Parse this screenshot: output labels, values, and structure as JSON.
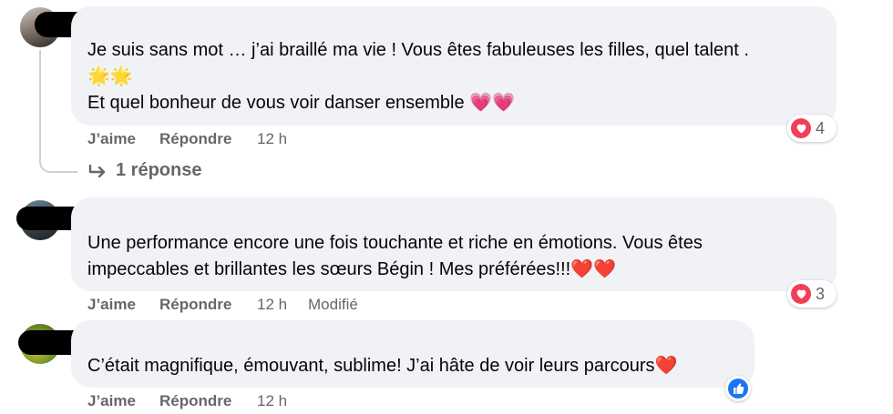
{
  "comments": [
    {
      "lines": [
        "Je suis sans mot … j’ai braillé ma vie ! Vous êtes fabuleuses les filles, quel talent .",
        "🌟🌟",
        "Et quel bonheur de vous voir danser ensemble 💗💗"
      ],
      "actions": {
        "like": "J’aime",
        "reply": "Répondre",
        "time": "12 h"
      },
      "reaction": {
        "icon": "heart-icon",
        "count": "4"
      },
      "replies_label": "1 réponse"
    },
    {
      "lines": [
        "Une performance encore une fois touchante et riche en émotions. Vous êtes",
        "impeccables et brillantes les sœurs Bégin ! Mes préférées!!!❤️❤️"
      ],
      "actions": {
        "like": "J’aime",
        "reply": "Répondre",
        "time": "12 h",
        "edited": "Modifié"
      },
      "reaction": {
        "icon": "heart-icon",
        "count": "3"
      }
    },
    {
      "lines": [
        "C’était magnifique, émouvant, sublime! J’ai hâte de voir leurs parcours❤️"
      ],
      "actions": {
        "like": "J’aime",
        "reply": "Répondre",
        "time": "12 h"
      },
      "reaction": {
        "icon": "thumbs-up-icon"
      }
    }
  ],
  "colors": {
    "bubble": "#f0f2f5",
    "secondary_text": "#65676b",
    "love": "#f33e58",
    "like": "#1877f2",
    "redaction": "#000000"
  }
}
